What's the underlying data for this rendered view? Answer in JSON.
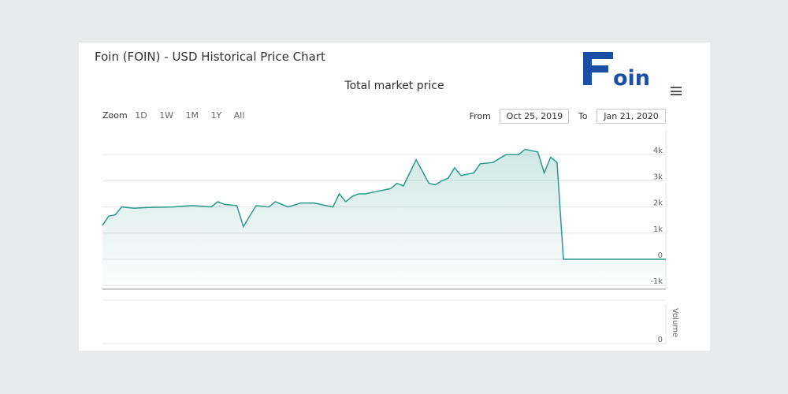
{
  "page": {
    "title": "Foin (FOIN) - USD Historical Price Chart",
    "logo_text": "oin"
  },
  "toolbar": {
    "zoom_label": "Zoom",
    "zoom_buttons": [
      "1D",
      "1W",
      "1M",
      "1Y",
      "All"
    ],
    "from_label": "From",
    "from_value": "Oct 25, 2019",
    "to_label": "To",
    "to_value": "Jan 21, 2020"
  },
  "colors": {
    "line": "#2a9a8a",
    "logo": "#1b4fa6",
    "grid": "#e6e6e6"
  },
  "chart_data": {
    "type": "area",
    "title": "Total market price",
    "x": [
      "2019-10-25",
      "2019-10-26",
      "2019-10-27",
      "2019-10-28",
      "2019-10-30",
      "2019-11-01",
      "2019-11-05",
      "2019-11-08",
      "2019-11-11",
      "2019-11-12",
      "2019-11-13",
      "2019-11-15",
      "2019-11-16",
      "2019-11-18",
      "2019-11-20",
      "2019-11-21",
      "2019-11-23",
      "2019-11-25",
      "2019-11-27",
      "2019-11-30",
      "2019-12-01",
      "2019-12-02",
      "2019-12-03",
      "2019-12-04",
      "2019-12-05",
      "2019-12-07",
      "2019-12-09",
      "2019-12-10",
      "2019-12-11",
      "2019-12-13",
      "2019-12-15",
      "2019-12-16",
      "2019-12-17",
      "2019-12-18",
      "2019-12-19",
      "2019-12-20",
      "2019-12-22",
      "2019-12-23",
      "2019-12-25",
      "2019-12-27",
      "2019-12-29",
      "2019-12-30",
      "2019-12-31",
      "2020-01-01",
      "2020-01-02",
      "2020-01-03",
      "2020-01-04",
      "2020-01-05",
      "2020-01-21"
    ],
    "values": [
      1300,
      1650,
      1700,
      2000,
      1950,
      1980,
      2000,
      2050,
      2000,
      2200,
      2100,
      2050,
      1250,
      2050,
      2000,
      2200,
      2000,
      2150,
      2150,
      2000,
      2500,
      2200,
      2400,
      2500,
      2500,
      2600,
      2700,
      2900,
      2800,
      3800,
      2900,
      2850,
      3000,
      3100,
      3500,
      3200,
      3300,
      3650,
      3700,
      4000,
      4000,
      4200,
      4150,
      4100,
      3300,
      3900,
      3700,
      0,
      0
    ],
    "y_axis": {
      "ticks": [
        "-1k",
        "0",
        "1k",
        "2k",
        "3k",
        "4k"
      ],
      "min": -1000,
      "max": 4500
    },
    "volume_axis": {
      "label": "Volume",
      "ticks": [
        "0"
      ]
    },
    "grid": true,
    "legend": "none"
  }
}
